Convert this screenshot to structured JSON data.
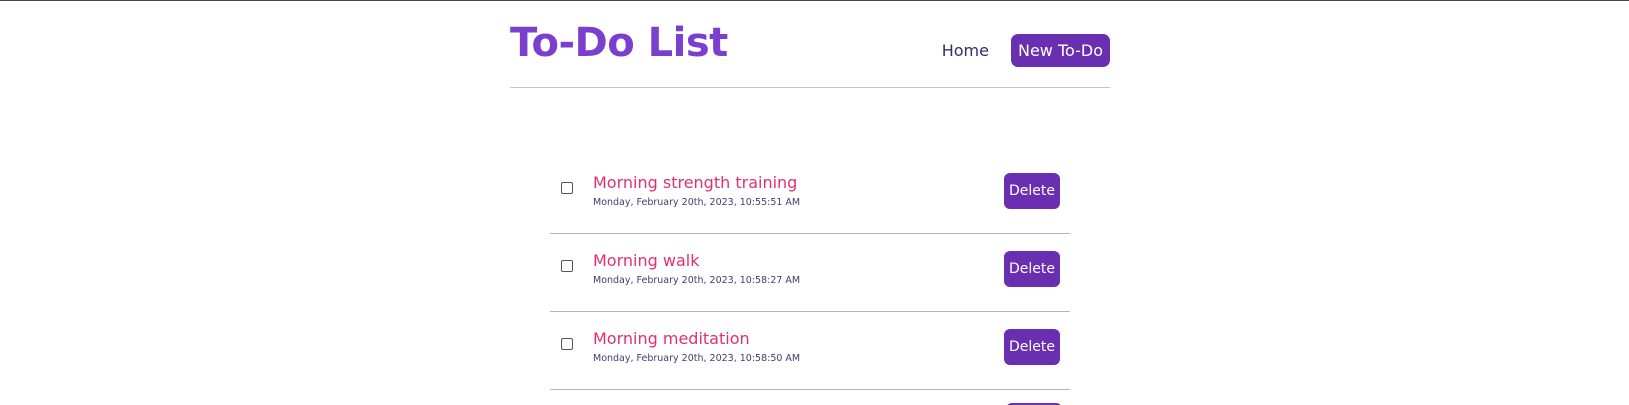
{
  "header": {
    "title": "To-Do List",
    "nav": {
      "home_label": "Home",
      "new_label": "New To-Do"
    }
  },
  "todos": [
    {
      "title": "Morning strength training",
      "date": "Monday, February 20th, 2023, 10:55:51 AM",
      "checked": false,
      "delete_label": "Delete"
    },
    {
      "title": "Morning walk",
      "date": "Monday, February 20th, 2023, 10:58:27 AM",
      "checked": false,
      "delete_label": "Delete"
    },
    {
      "title": "Morning meditation",
      "date": "Monday, February 20th, 2023, 10:58:50 AM",
      "checked": false,
      "delete_label": "Delete"
    }
  ],
  "colors": {
    "brand": "#7b3fcf",
    "button": "#6a2fb0",
    "todo_title": "#e2306c",
    "date_text": "#4a3a6b"
  }
}
